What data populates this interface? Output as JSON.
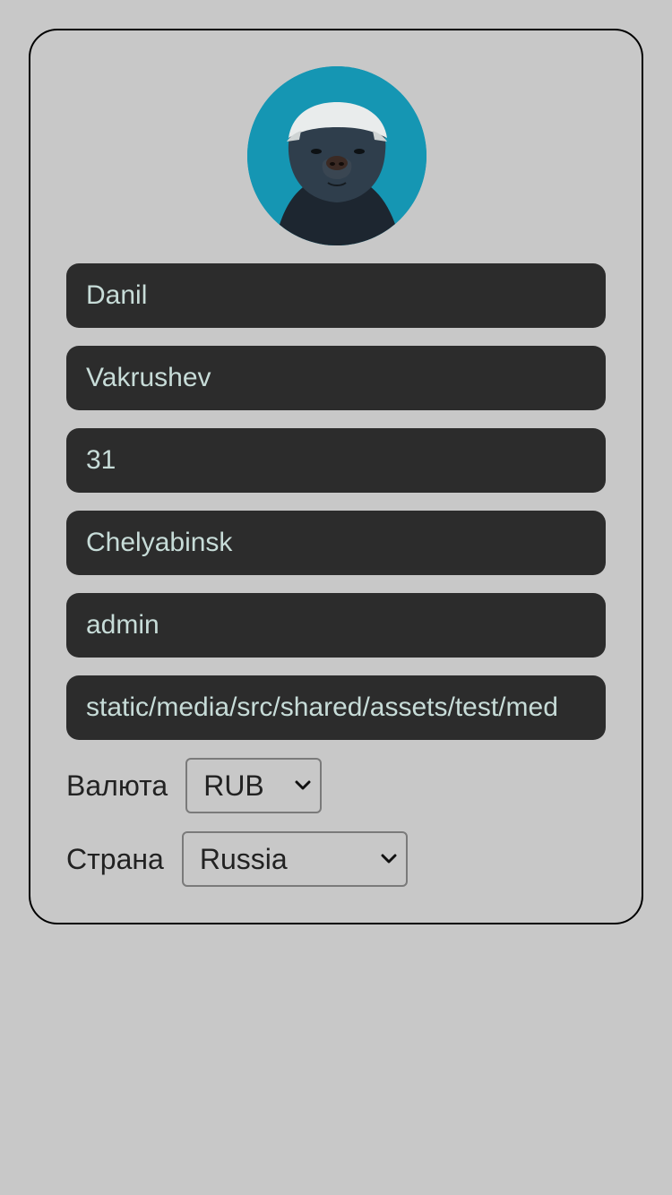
{
  "profile": {
    "avatar_alt": "honey badger avatar",
    "first_name": "Danil",
    "last_name": "Vakrushev",
    "age": "31",
    "city": "Chelyabinsk",
    "username": "admin",
    "avatar_path": "static/media/src/shared/assets/test/med"
  },
  "currency": {
    "label": "Валюта",
    "selected": "RUB"
  },
  "country": {
    "label": "Страна",
    "selected": "Russia"
  },
  "colors": {
    "background": "#c8c8c8",
    "field_bg": "#2c2c2c",
    "field_text": "#c7dcd8",
    "avatar_bg": "#1596b3"
  },
  "icons": {
    "select_arrow": "chevron-down-icon"
  }
}
